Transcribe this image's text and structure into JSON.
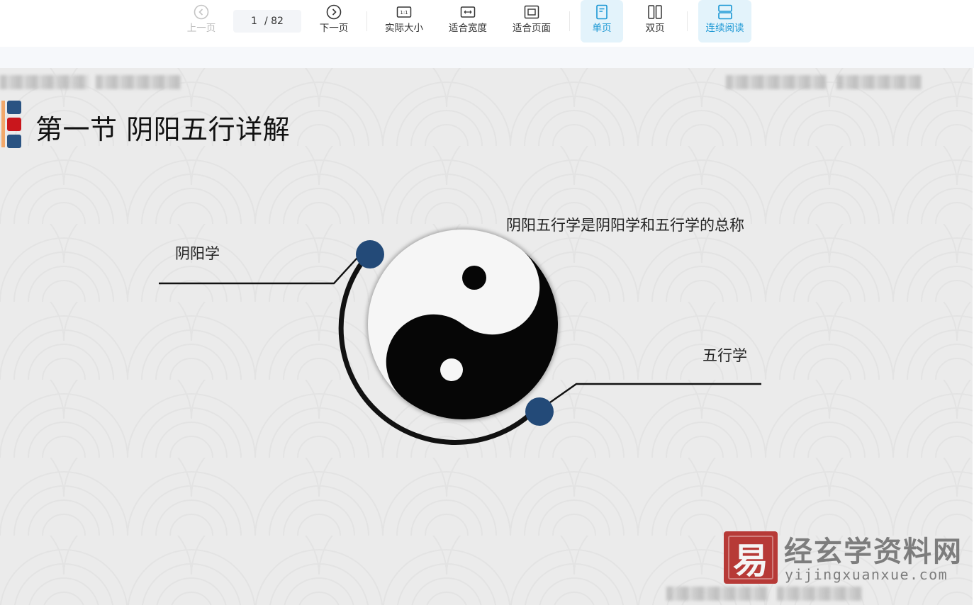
{
  "toolbar": {
    "prev_label": "上一页",
    "page_current": "1",
    "page_total": "/ 82",
    "next_label": "下一页",
    "actual_size_label": "实际大小",
    "fit_width_label": "适合宽度",
    "fit_page_label": "适合页面",
    "single_page_label": "单页",
    "double_page_label": "双页",
    "continuous_label": "连续阅读",
    "active_color": "#1a97d4"
  },
  "slide": {
    "title": "第一节 阴阳五行详解",
    "summary": "阴阳五行学是阴阳学和五行学的总称",
    "left_label": "阴阳学",
    "right_label": "五行学",
    "dot_color": "#234a78",
    "marker_colors": [
      "#2a5382",
      "#c9161c",
      "#2a5382"
    ]
  },
  "watermark": {
    "name": "经玄学资料网",
    "url": "yijingxuanxue.com",
    "seal_glyph": "易"
  }
}
